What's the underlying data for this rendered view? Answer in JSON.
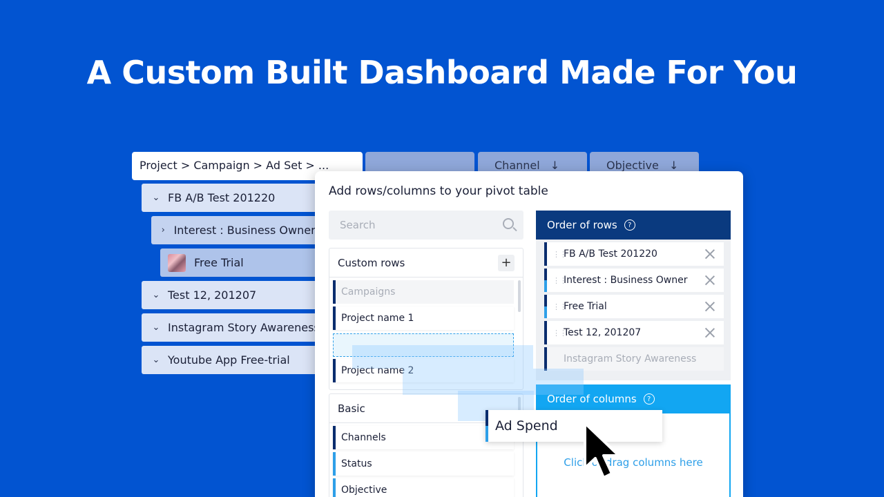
{
  "headline": "A Custom Built Dashboard Made For You",
  "tree": {
    "header": "Project > Campaign > Ad Set > ...",
    "columns": [
      "",
      "Channel",
      "Objective"
    ],
    "rows": [
      {
        "label": "FB A/B Test 201220",
        "chevron": "chevron-down"
      },
      {
        "label": "Interest : Business Owners",
        "chevron": "chevron-right"
      },
      {
        "label": "Free Trial"
      },
      {
        "label": "Test 12, 201207",
        "chevron": "chevron-down"
      },
      {
        "label": "Instagram Story Awareness",
        "chevron": "chevron-down"
      },
      {
        "label": "Youtube App Free-trial",
        "chevron": "chevron-down"
      }
    ]
  },
  "modal": {
    "title": "Add rows/columns to your pivot table",
    "search_placeholder": "Search",
    "custom_rows": {
      "label": "Custom rows",
      "items": [
        "Campaigns",
        "Project name 1",
        "Project name 2"
      ]
    },
    "basic": {
      "label": "Basic",
      "items": [
        "Channels",
        "Status",
        "Objective"
      ]
    },
    "order_of_rows": {
      "label": "Order of rows",
      "items": [
        "FB A/B Test 201220",
        "Interest : Business Owner",
        "Free Trial",
        "Test 12, 201207",
        "Instagram Story Awareness"
      ]
    },
    "order_of_columns": {
      "label": "Order of columns",
      "hint": "Click or drag columns here"
    },
    "dragging": "Ad Spend"
  },
  "colors": {
    "background": "#0254d1",
    "accent_dark": "#0a3a7f",
    "accent_light": "#12a6f2"
  }
}
